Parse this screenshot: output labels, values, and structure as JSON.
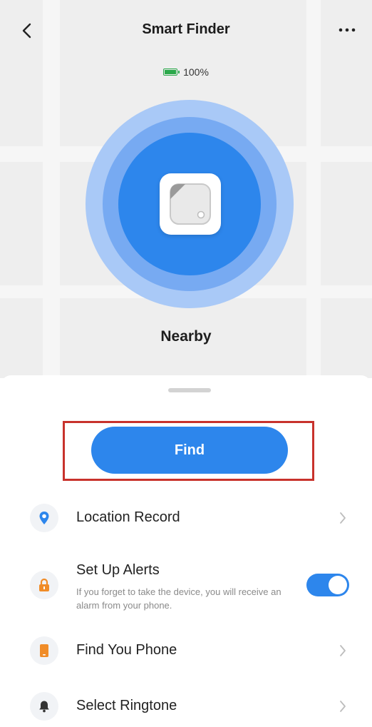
{
  "header": {
    "title": "Smart Finder"
  },
  "device": {
    "battery_level": 1.0,
    "battery_text": "100%",
    "status": "Nearby"
  },
  "actions": {
    "find_label": "Find"
  },
  "colors": {
    "accent": "#2d86ec",
    "highlight_border": "#c8322c",
    "battery": "#2aa84a"
  },
  "menu": [
    {
      "label": "Location Record",
      "icon": "location-pin-icon",
      "icon_color": "#2d86ec",
      "has_chevron": true
    },
    {
      "label": "Set Up Alerts",
      "icon": "lock-icon",
      "icon_color": "#f08c28",
      "description": "If you forget to take the device, you will receive an alarm from your phone.",
      "toggle_on": true
    },
    {
      "label": "Find You Phone",
      "icon": "phone-icon",
      "icon_color": "#f08c28",
      "has_chevron": true
    },
    {
      "label": "Select Ringtone",
      "icon": "bell-icon",
      "icon_color": "#333333",
      "has_chevron": true
    }
  ]
}
